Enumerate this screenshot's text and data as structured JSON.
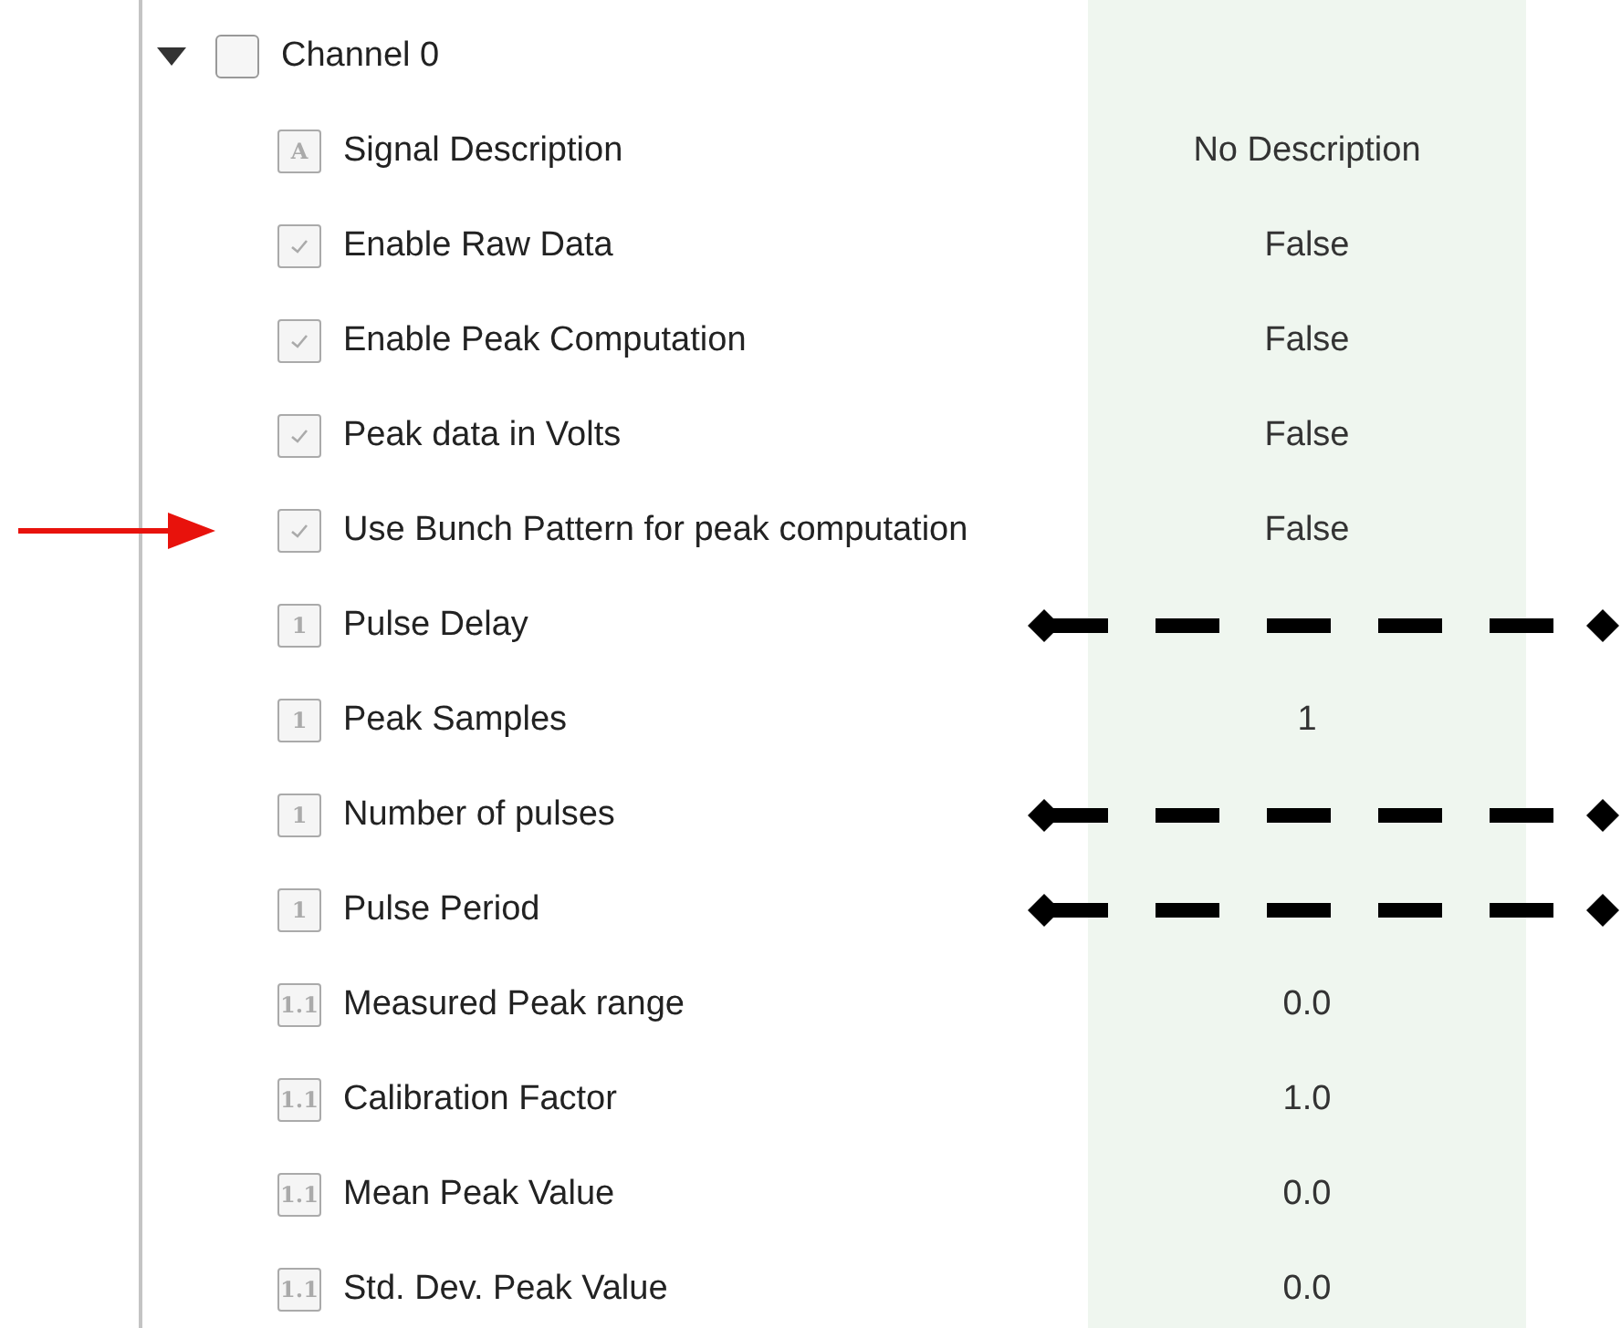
{
  "tree": {
    "label": "Channel 0",
    "expanded": true,
    "checked": false,
    "children": [
      {
        "kind": "text",
        "icon_text": "A",
        "label": "Signal Description",
        "value": "No Description",
        "pointer_arrow": false,
        "dashed_line": false
      },
      {
        "kind": "bool",
        "label": "Enable Raw Data",
        "value": "False",
        "pointer_arrow": false,
        "dashed_line": false
      },
      {
        "kind": "bool",
        "label": "Enable Peak Computation",
        "value": "False",
        "pointer_arrow": false,
        "dashed_line": false
      },
      {
        "kind": "bool",
        "label": "Peak data in Volts",
        "value": "False",
        "pointer_arrow": false,
        "dashed_line": false
      },
      {
        "kind": "bool",
        "label": "Use Bunch Pattern for peak computation",
        "value": "False",
        "pointer_arrow": true,
        "dashed_line": false
      },
      {
        "kind": "text",
        "icon_text": "1",
        "label": "Pulse Delay",
        "pointer_arrow": false,
        "dashed_line": true
      },
      {
        "kind": "text",
        "icon_text": "1",
        "label": "Peak Samples",
        "value": "1",
        "pointer_arrow": false,
        "dashed_line": false
      },
      {
        "kind": "text",
        "icon_text": "1",
        "label": "Number of pulses",
        "pointer_arrow": false,
        "dashed_line": true
      },
      {
        "kind": "text",
        "icon_text": "1",
        "label": "Pulse Period",
        "pointer_arrow": false,
        "dashed_line": true
      },
      {
        "kind": "text",
        "icon_text": "1.1",
        "label": "Measured Peak range",
        "value": "0.0",
        "pointer_arrow": false,
        "dashed_line": false
      },
      {
        "kind": "text",
        "icon_text": "1.1",
        "label": "Calibration Factor",
        "value": "1.0",
        "pointer_arrow": false,
        "dashed_line": false
      },
      {
        "kind": "text",
        "icon_text": "1.1",
        "label": "Mean Peak Value",
        "value": "0.0",
        "pointer_arrow": false,
        "dashed_line": false
      },
      {
        "kind": "text",
        "icon_text": "1.1",
        "label": "Std. Dev. Peak Value",
        "value": "0.0",
        "pointer_arrow": false,
        "dashed_line": false
      }
    ]
  }
}
